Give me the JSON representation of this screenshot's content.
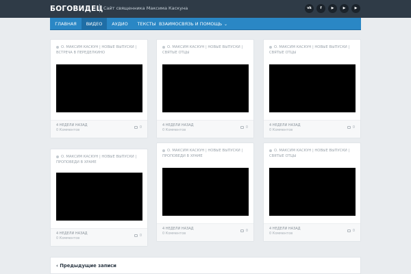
{
  "header": {
    "site_title": "БОГОВИДЕЦ",
    "separator": "|",
    "tagline": "Сайт священника Максима Каскуна",
    "social": [
      {
        "icon": "vk-icon",
        "glyph": "vk"
      },
      {
        "icon": "facebook-icon",
        "glyph": "f"
      },
      {
        "icon": "youtube-icon",
        "glyph": "▶"
      },
      {
        "icon": "youtube-icon",
        "glyph": "▶"
      },
      {
        "icon": "youtube-icon",
        "glyph": "▶"
      }
    ]
  },
  "nav": {
    "items": [
      {
        "label": "ГЛАВНАЯ"
      },
      {
        "label": "ВИДЕО"
      },
      {
        "label": "АУДИО"
      },
      {
        "label": "ТЕКСТЫ"
      },
      {
        "label": "ВЗАИМОСВЯЗЬ И ПОМОЩЬ"
      }
    ],
    "active": "ВИДЕО",
    "chevron": "⌄"
  },
  "posts": [
    {
      "meta": "О. МАКСИМ КАСКУН | НОВЫЕ ВЫПУСКИ | ВСТРЕЧА В ПЕРЕДЕЛКИНО",
      "time": "4 НЕДЕЛИ НАЗАД",
      "comments": "0 Комментов",
      "count": "0"
    },
    {
      "meta": "О. МАКСИМ КАСКУН | НОВЫЕ ВЫПУСКИ | СВЯТЫЕ ОТЦЫ",
      "time": "4 НЕДЕЛИ НАЗАД",
      "comments": "0 Комментов",
      "count": "0"
    },
    {
      "meta": "О. МАКСИМ КАСКУН | НОВЫЕ ВЫПУСКИ | СВЯТЫЕ ОТЦЫ",
      "time": "4 НЕДЕЛИ НАЗАД",
      "comments": "0 Комментов",
      "count": "0"
    },
    {
      "meta": "О. МАКСИМ КАСКУН | НОВЫЕ ВЫПУСКИ | ПРОПОВЕДИ В ХРАМЕ",
      "time": "4 НЕДЕЛИ НАЗАД",
      "comments": "0 Комментов",
      "count": "0"
    },
    {
      "meta": "О. МАКСИМ КАСКУН | НОВЫЕ ВЫПУСКИ | ПРОПОВЕДИ В ХРАМЕ",
      "time": "4 НЕДЕЛИ НАЗАД",
      "comments": "0 Комментов",
      "count": "0"
    },
    {
      "meta": "О. МАКСИМ КАСКУН | НОВЫЕ ВЫПУСКИ | СВЯТЫЕ ОТЦЫ",
      "time": "4 НЕДЕЛИ НАЗАД",
      "comments": "0 Комментов",
      "count": "0"
    }
  ],
  "pagination": {
    "arrow": "‹",
    "prev_label": "Предыдущие записи"
  },
  "colors": {
    "header_bg": "#2f3b47",
    "nav_bg": "#2a87c5",
    "nav_active": "#1f6ea6",
    "page_bg": "#e9ecef",
    "video_bg": "#000000"
  }
}
